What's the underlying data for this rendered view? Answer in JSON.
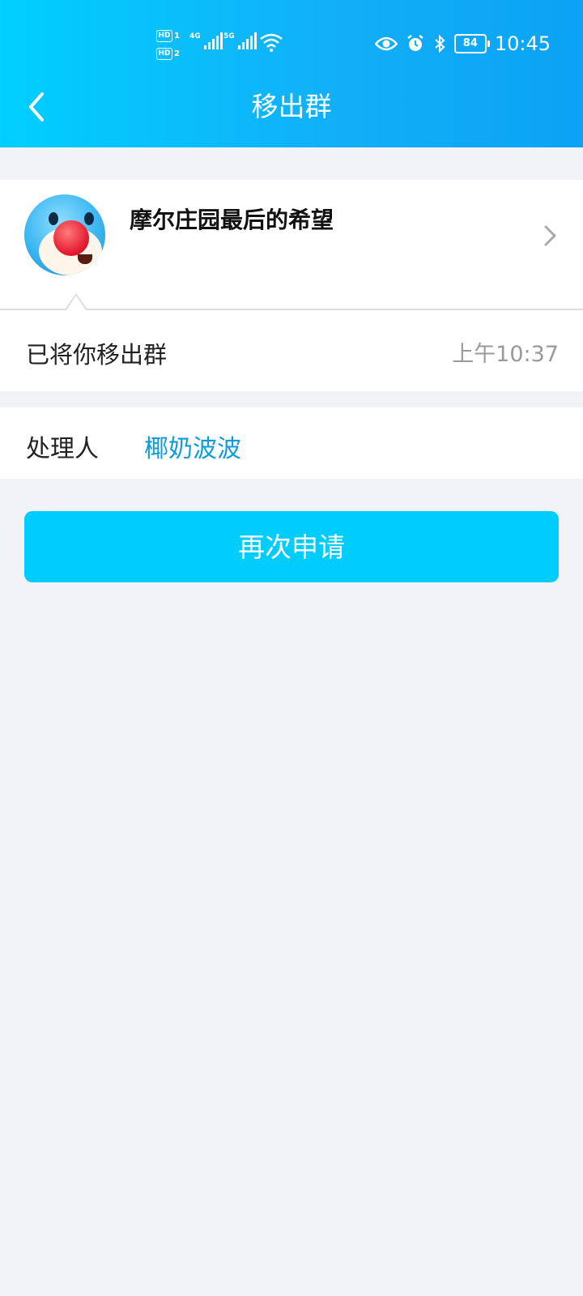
{
  "status_bar": {
    "hd1": "HD",
    "hd1_num": "1",
    "hd2": "HD",
    "hd2_num": "2",
    "net1": "4G",
    "net2": "5G",
    "battery": "84",
    "time": "10:45",
    "icons": [
      "eye-icon",
      "alarm-icon",
      "bluetooth-icon",
      "wifi-icon",
      "signal-icon"
    ]
  },
  "header": {
    "title": "移出群",
    "back_icon": "chevron-left-icon"
  },
  "group": {
    "name": "摩尔庄园最后的希望",
    "avatar": "mole-avatar",
    "arrow_icon": "chevron-right-icon"
  },
  "message": {
    "text": "已将你移出群",
    "time": "上午10:37"
  },
  "handler": {
    "label": "处理人",
    "name": "椰奶波波"
  },
  "actions": {
    "reapply_label": "再次申请"
  },
  "colors": {
    "header_start": "#00cfff",
    "header_end": "#0aa3f5",
    "button": "#00cdfd",
    "link": "#0d9bdc",
    "background": "#f2f3f7"
  }
}
